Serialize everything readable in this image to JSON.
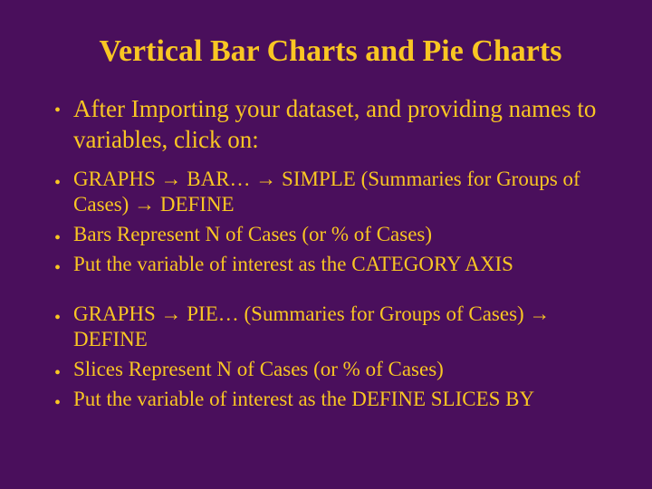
{
  "title": "Vertical Bar Charts and Pie Charts",
  "intro": {
    "items": [
      {
        "text": "After Importing your dataset, and providing names to variables, click on:"
      }
    ]
  },
  "group1": {
    "items": [
      {
        "text": "GRAPHS → BAR… → SIMPLE (Summaries for Groups of Cases) → DEFINE"
      },
      {
        "text": "Bars Represent N of Cases (or % of Cases)"
      },
      {
        "text": "Put the variable of interest as the CATEGORY AXIS"
      }
    ]
  },
  "group2": {
    "items": [
      {
        "text": "GRAPHS → PIE… (Summaries for Groups of Cases) → DEFINE"
      },
      {
        "text": "Slices Represent N of Cases (or % of Cases)"
      },
      {
        "text": "Put the variable of interest as the DEFINE SLICES BY"
      }
    ]
  }
}
